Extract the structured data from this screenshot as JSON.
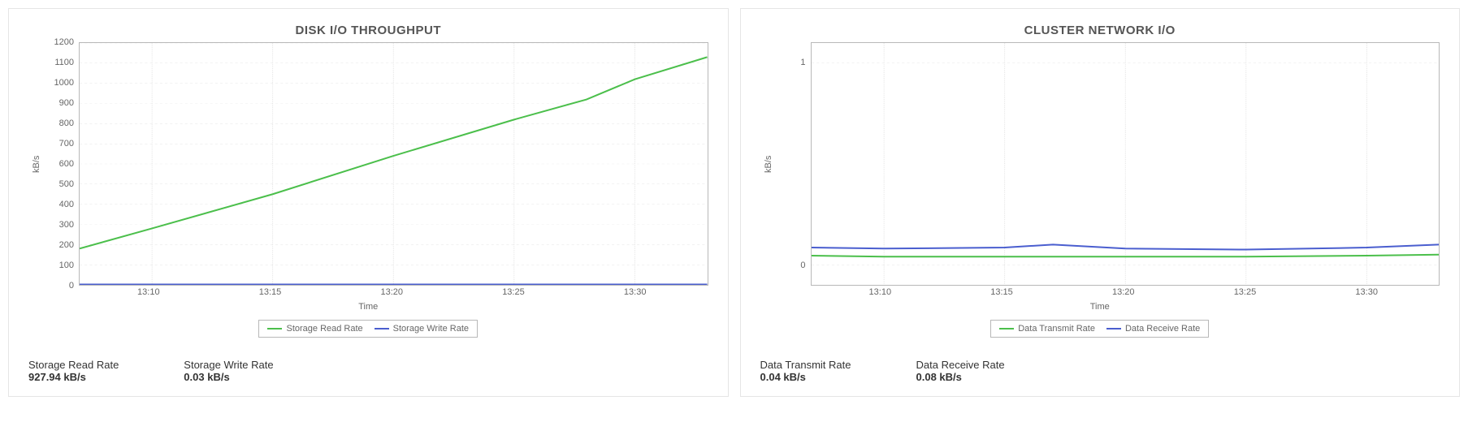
{
  "colors": {
    "green": "#4bbf4b",
    "blue": "#4a5ecf"
  },
  "chart_data": [
    {
      "id": "disk",
      "type": "line",
      "title": "DISK I/O THROUGHPUT",
      "xlabel": "Time",
      "ylabel": "kB/s",
      "x_ticks": [
        "13:10",
        "13:15",
        "13:20",
        "13:25",
        "13:30"
      ],
      "y_ticks": [
        0,
        100,
        200,
        300,
        400,
        500,
        600,
        700,
        800,
        900,
        1000,
        1100,
        1200
      ],
      "ylim": [
        0,
        1200
      ],
      "series": [
        {
          "name": "Storage Read Rate",
          "color": "#4bbf4b",
          "x": [
            "13:07",
            "13:10",
            "13:15",
            "13:20",
            "13:25",
            "13:28",
            "13:30",
            "13:33"
          ],
          "values": [
            180,
            280,
            450,
            640,
            820,
            920,
            1020,
            1130
          ]
        },
        {
          "name": "Storage Write Rate",
          "color": "#4a5ecf",
          "x": [
            "13:07",
            "13:10",
            "13:15",
            "13:20",
            "13:25",
            "13:30",
            "13:33"
          ],
          "values": [
            2,
            2,
            2,
            2,
            2,
            2,
            2
          ]
        }
      ],
      "legend": [
        "Storage Read Rate",
        "Storage Write Rate"
      ],
      "stats": [
        {
          "label": "Storage Read Rate",
          "value": "927.94 kB/s"
        },
        {
          "label": "Storage Write Rate",
          "value": "0.03 kB/s"
        }
      ]
    },
    {
      "id": "net",
      "type": "line",
      "title": "CLUSTER NETWORK I/O",
      "xlabel": "Time",
      "ylabel": "kB/s",
      "x_ticks": [
        "13:10",
        "13:15",
        "13:20",
        "13:25",
        "13:30"
      ],
      "y_ticks": [
        0,
        1
      ],
      "ylim": [
        -0.1,
        1.1
      ],
      "series": [
        {
          "name": "Data Transmit Rate",
          "color": "#4bbf4b",
          "x": [
            "13:07",
            "13:10",
            "13:15",
            "13:20",
            "13:25",
            "13:30",
            "13:33"
          ],
          "values": [
            0.045,
            0.04,
            0.04,
            0.04,
            0.04,
            0.045,
            0.05
          ]
        },
        {
          "name": "Data Receive Rate",
          "color": "#4a5ecf",
          "x": [
            "13:07",
            "13:10",
            "13:15",
            "13:17",
            "13:20",
            "13:25",
            "13:30",
            "13:33"
          ],
          "values": [
            0.085,
            0.08,
            0.085,
            0.1,
            0.08,
            0.075,
            0.085,
            0.1
          ]
        }
      ],
      "legend": [
        "Data Transmit Rate",
        "Data Receive Rate"
      ],
      "stats": [
        {
          "label": "Data Transmit Rate",
          "value": "0.04 kB/s"
        },
        {
          "label": "Data Receive Rate",
          "value": "0.08 kB/s"
        }
      ]
    }
  ]
}
